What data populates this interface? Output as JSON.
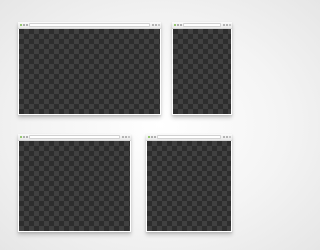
{
  "windows": [
    {
      "id": "win1",
      "content": "transparent-checkerboard"
    },
    {
      "id": "win2",
      "content": "transparent-checkerboard"
    },
    {
      "id": "win3",
      "content": "transparent-checkerboard"
    },
    {
      "id": "win4",
      "content": "transparent-checkerboard"
    }
  ],
  "colors": {
    "background": "#f4f4f4",
    "toolbar": "#eeeeee",
    "checker_dark": "#2d2d2d",
    "checker_light": "#404040",
    "back_button": "#79b94a"
  },
  "icons": [
    "back-arrow-icon",
    "forward-arrow-icon",
    "reload-icon",
    "menu-icon",
    "close-icon"
  ]
}
